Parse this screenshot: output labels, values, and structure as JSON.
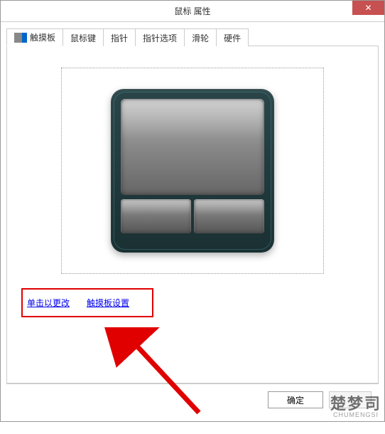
{
  "window": {
    "title": "鼠标 属性",
    "close_label": "✕"
  },
  "tabs": [
    {
      "label": "触摸板"
    },
    {
      "label": "鼠标键"
    },
    {
      "label": "指针"
    },
    {
      "label": "指针选项"
    },
    {
      "label": "滑轮"
    },
    {
      "label": "硬件"
    }
  ],
  "settings_link": {
    "part1": "单击以更改",
    "part2": "触摸板设置"
  },
  "buttons": {
    "ok": "确定"
  },
  "watermark": {
    "cn": "楚梦司",
    "en": "CHUMENGSI"
  }
}
